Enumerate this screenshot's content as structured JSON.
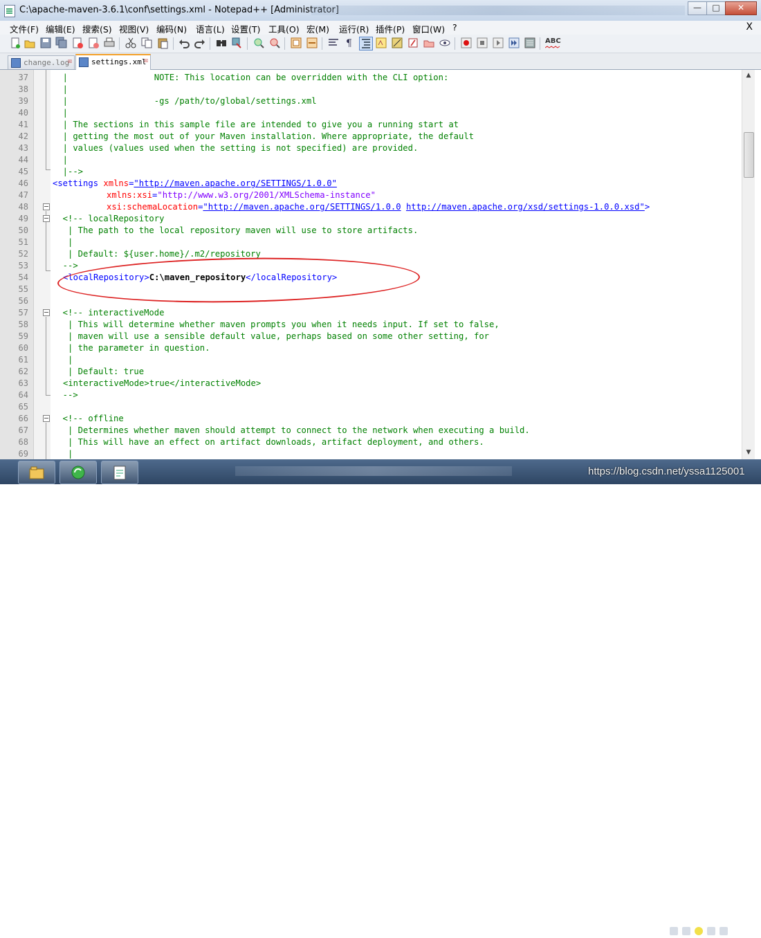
{
  "window": {
    "title": "C:\\apache-maven-3.6.1\\conf\\settings.xml - Notepad++ [Administrator]",
    "controls": {
      "minimize": "—",
      "maximize": "□",
      "close": "✕"
    }
  },
  "menu": {
    "items": [
      "文件(F)",
      "编辑(E)",
      "搜索(S)",
      "视图(V)",
      "编码(N)",
      "语言(L)",
      "设置(T)",
      "工具(O)",
      "宏(M)",
      "运行(R)",
      "插件(P)",
      "窗口(W)",
      "?"
    ],
    "close_doc": "X"
  },
  "toolbar": {
    "spellcheck_label": "ABC"
  },
  "tabs": [
    {
      "label": "change.log",
      "active": false
    },
    {
      "label": "settings.xml",
      "active": true
    }
  ],
  "editor": {
    "lines": [
      {
        "n": "37",
        "text": "  |                 NOTE: This location can be overridden with the CLI option:"
      },
      {
        "n": "38",
        "text": "  |"
      },
      {
        "n": "39",
        "text": "  |                 -gs /path/to/global/settings.xml"
      },
      {
        "n": "40",
        "text": "  |"
      },
      {
        "n": "41",
        "text": "  | The sections in this sample file are intended to give you a running start at"
      },
      {
        "n": "42",
        "text": "  | getting the most out of your Maven installation. Where appropriate, the default"
      },
      {
        "n": "43",
        "text": "  | values (values used when the setting is not specified) are provided."
      },
      {
        "n": "44",
        "text": "  |"
      },
      {
        "n": "45",
        "text": "  |-->"
      },
      {
        "n": "46",
        "text": ""
      },
      {
        "n": "47",
        "text": ""
      },
      {
        "n": "48",
        "text": ""
      },
      {
        "n": "49",
        "text": "  <!-- localRepository"
      },
      {
        "n": "50",
        "text": "   | The path to the local repository maven will use to store artifacts."
      },
      {
        "n": "51",
        "text": "   |"
      },
      {
        "n": "52",
        "text": "   | Default: ${user.home}/.m2/repository"
      },
      {
        "n": "53",
        "text": "  -->"
      },
      {
        "n": "54",
        "text": ""
      },
      {
        "n": "55",
        "text": ""
      },
      {
        "n": "56",
        "text": ""
      },
      {
        "n": "57",
        "text": "  <!-- interactiveMode"
      },
      {
        "n": "58",
        "text": "   | This will determine whether maven prompts you when it needs input. If set to false,"
      },
      {
        "n": "59",
        "text": "   | maven will use a sensible default value, perhaps based on some other setting, for"
      },
      {
        "n": "60",
        "text": "   | the parameter in question."
      },
      {
        "n": "61",
        "text": "   |"
      },
      {
        "n": "62",
        "text": "   | Default: true"
      },
      {
        "n": "63",
        "text": ""
      },
      {
        "n": "64",
        "text": "  -->"
      },
      {
        "n": "65",
        "text": ""
      },
      {
        "n": "66",
        "text": "  <!-- offline"
      },
      {
        "n": "67",
        "text": "   | Determines whether maven should attempt to connect to the network when executing a build."
      },
      {
        "n": "68",
        "text": "   | This will have an effect on artifact downloads, artifact deployment, and others."
      },
      {
        "n": "69",
        "text": "   |"
      }
    ],
    "settings_tag": {
      "open": "<settings",
      "attr1": "xmlns",
      "val1": "\"http://maven.apache.org/SETTINGS/1.0.0\"",
      "attr2": "xmlns:xsi",
      "val2": "\"http://www.w3.org/2001/XMLSchema-instance\"",
      "attr3": "xsi:schemaLocation",
      "val3a": "\"http://maven.apache.org/SETTINGS/1.0.0",
      "val3b": "http://maven.apache.org/xsd/settings-1.0.0.xsd\"",
      "close": ">"
    },
    "local_repo": {
      "open_tag": "<localRepository>",
      "value": "C:\\maven_repository",
      "close_tag": "</localRepository>"
    },
    "interactive_mode": {
      "open_tag": "<interactiveMode>",
      "value": "true",
      "close_tag": "</interactiveMode>"
    }
  },
  "watermark": "https://blog.csdn.net/yssa1125001"
}
